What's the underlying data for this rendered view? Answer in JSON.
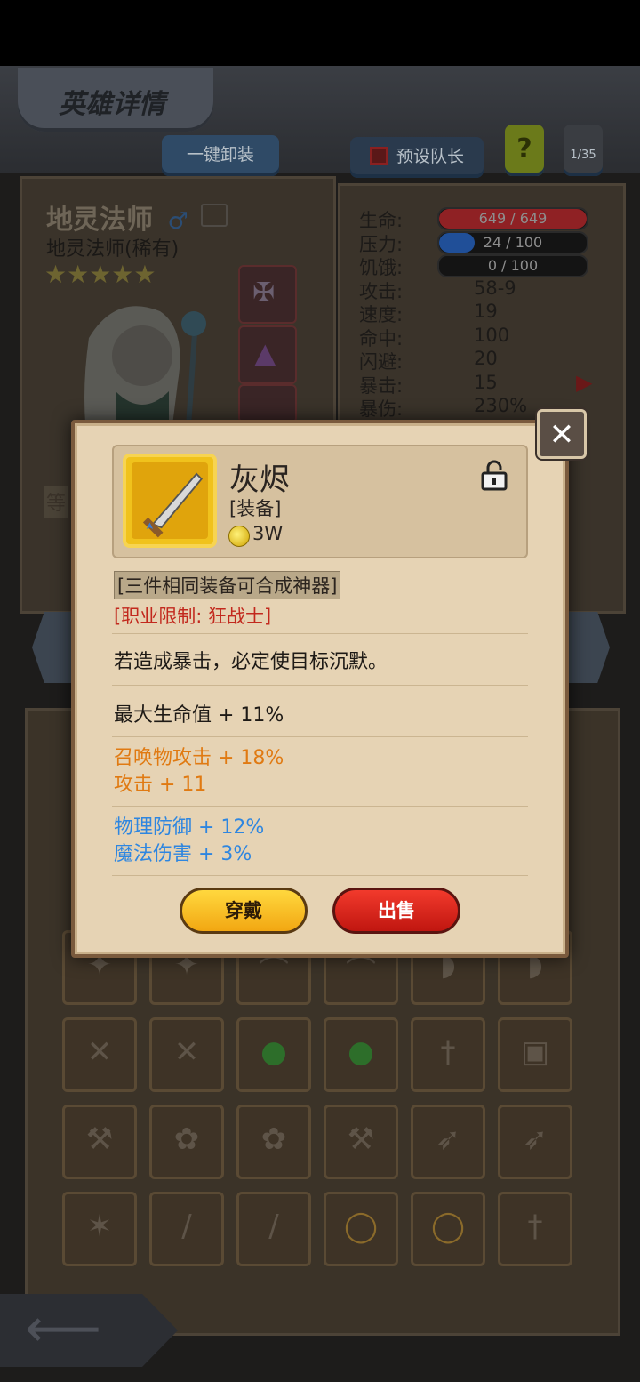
{
  "screen": {
    "title": "英雄详情",
    "unequip_all_label": "一键卸装",
    "preset_leader_label": "预设队长",
    "help_label": "?",
    "page_counter": "1/35"
  },
  "hero": {
    "name": "地灵法师",
    "subtitle": "地灵法师(稀有)",
    "star_count": 5,
    "stars": "★★★★★",
    "level_label_fragment": "等"
  },
  "stats": [
    {
      "label": "生命:",
      "value": "649 / 649",
      "bar": true,
      "fill": 1.0,
      "color": "#b8262a"
    },
    {
      "label": "压力:",
      "value": "24 / 100",
      "bar": true,
      "fill": 0.24,
      "color": "#2463c4"
    },
    {
      "label": "饥饿:",
      "value": "0 / 100",
      "bar": true,
      "fill": 0.0,
      "color": "#555555"
    },
    {
      "label": "攻击:",
      "value": "58-9"
    },
    {
      "label": "速度:",
      "value": "19"
    },
    {
      "label": "命中:",
      "value": "100"
    },
    {
      "label": "闪避:",
      "value": "20"
    },
    {
      "label": "暴击:",
      "value": "15"
    },
    {
      "label": "暴伤:",
      "value": "230%"
    }
  ],
  "item": {
    "name": "灰烬",
    "type": "[装备]",
    "price": "3W",
    "combine_hint": "[三件相同装备可合成神器]",
    "class_restriction": "[职业限制: 狂战士]",
    "effect_text": "若造成暴击，必定使目标沉默。",
    "attrs_white": [
      "最大生命值 + 11%"
    ],
    "attrs_orange": [
      "召唤物攻击 + 18%",
      "攻击 + 11"
    ],
    "attrs_blue": [
      "物理防御 + 12%",
      "魔法伤害 + 3%"
    ],
    "colors": {
      "white": "#1e1a16",
      "orange": "#e07a12",
      "blue": "#2e86e0",
      "red": "#c2281d"
    },
    "locked": true
  },
  "buttons": {
    "wear_label": "穿戴",
    "sell_label": "出售"
  },
  "inventory_icons": [
    "staff-icon",
    "staff-icon",
    "bow-icon",
    "bow-icon",
    "shield-icon",
    "shield-icon",
    "crossbow-icon",
    "crossbow-icon",
    "potion-icon",
    "potion-icon",
    "sword-icon",
    "armor-icon",
    "axe-icon",
    "fan-icon",
    "fan-icon",
    "axe-icon",
    "spear-icon",
    "spear-icon",
    "scepter-icon",
    "blade-icon",
    "blade-icon",
    "ring-icon",
    "ring-icon",
    "sword-icon"
  ]
}
